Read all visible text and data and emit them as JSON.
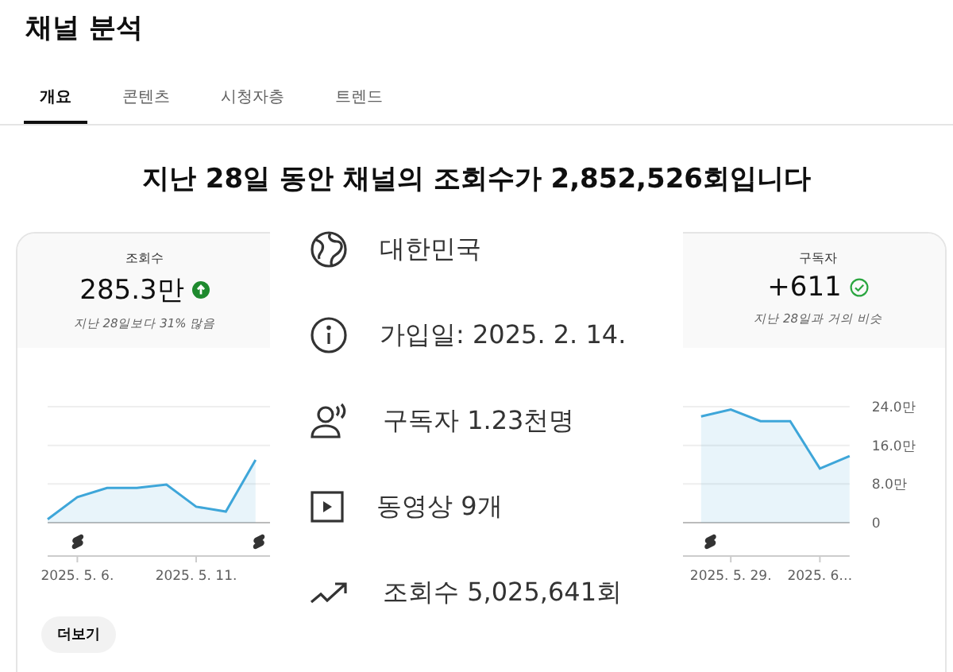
{
  "page_title": "채널 분석",
  "tabs": [
    {
      "label": "개요",
      "selected": true
    },
    {
      "label": "콘텐츠",
      "selected": false
    },
    {
      "label": "시청자층",
      "selected": false
    },
    {
      "label": "트렌드",
      "selected": false
    }
  ],
  "headline": "지난 28일 동안 채널의 조회수가 2,852,526회입니다",
  "metrics": [
    {
      "label": "조회수",
      "value": "285.3만",
      "kind": "up",
      "note": "지난 28일보다 31% 많음"
    },
    {
      "label": "구독자",
      "value": "+611",
      "kind": "same",
      "note": "지난 28일과 거의 비슷"
    }
  ],
  "chart_data": {
    "type": "area",
    "ylim": [
      0,
      24
    ],
    "yticks": [
      {
        "value": 0,
        "label": "0"
      },
      {
        "value": 8,
        "label": "8.0만"
      },
      {
        "value": 16,
        "label": "16.0만"
      },
      {
        "value": 24,
        "label": "24.0만"
      }
    ],
    "categories": [
      null,
      "2025. 5. 6.",
      null,
      null,
      null,
      "2025. 5. 11.",
      null,
      null,
      null,
      null,
      null,
      null,
      null,
      null,
      null,
      null,
      null,
      null,
      null,
      null,
      null,
      null,
      null,
      "2025. 5. 29.",
      null,
      null,
      "2025. 6…",
      null
    ],
    "series": [
      {
        "color": "#3ea6d9",
        "values": [
          0.7,
          5.3,
          7.2,
          7.2,
          7.9,
          3.3,
          2.3,
          13,
          null,
          null,
          null,
          null,
          null,
          null,
          null,
          null,
          null,
          null,
          null,
          null,
          null,
          null,
          22,
          23.4,
          21,
          21,
          11.2,
          13.8
        ]
      }
    ]
  },
  "more_button": "더보기",
  "about_panel": [
    {
      "kind": "globe",
      "text": "대한민국"
    },
    {
      "kind": "info",
      "text": "가입일: 2025. 2. 14."
    },
    {
      "kind": "subscribers",
      "text": "구독자 1.23천명"
    },
    {
      "kind": "video",
      "text": "동영상 9개"
    },
    {
      "kind": "views",
      "text": "조회수 5,025,641회"
    }
  ]
}
